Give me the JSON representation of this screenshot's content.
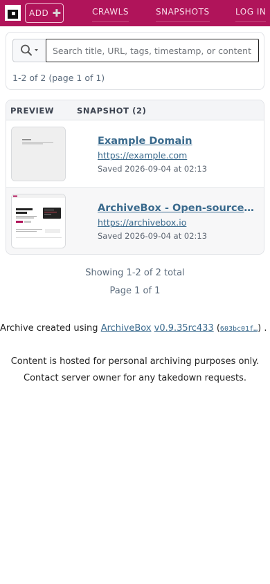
{
  "header": {
    "add_label": "ADD",
    "add_icon": "plus-icon",
    "nav": [
      "CRAWLS",
      "SNAPSHOTS",
      "LOG IN"
    ],
    "brand_color": "#b0145a"
  },
  "search": {
    "placeholder": "Search title, URL, tags, timestamp, or content...",
    "value": "",
    "icon": "search-icon",
    "dropdown_icon": "caret-down-icon"
  },
  "pagination_top": "1-2 of 2 (page 1 of 1)",
  "table": {
    "columns": [
      "PREVIEW",
      "SNAPSHOT (2)"
    ],
    "rows": [
      {
        "title": "Example Domain",
        "url": "https://example.com",
        "saved": "Saved 2026-09-04 at 02:13"
      },
      {
        "title": "ArchiveBox - Open-source self-hosted web archiving",
        "url": "https://archivebox.io",
        "saved": "Saved 2026-09-04 at 02:13"
      }
    ]
  },
  "summary": {
    "showing": "Showing 1-2 of 2 total",
    "page": "Page 1 of 1"
  },
  "footer": {
    "credit_prefix": "Archive created using",
    "product": "ArchiveBox",
    "version": "v0.9.35rc433",
    "commit": "603bc01f…",
    "credit_suffix": ") .",
    "notice_1": "Content is hosted for personal archiving purposes only.",
    "notice_2": "Contact server owner for any takedown requests."
  }
}
